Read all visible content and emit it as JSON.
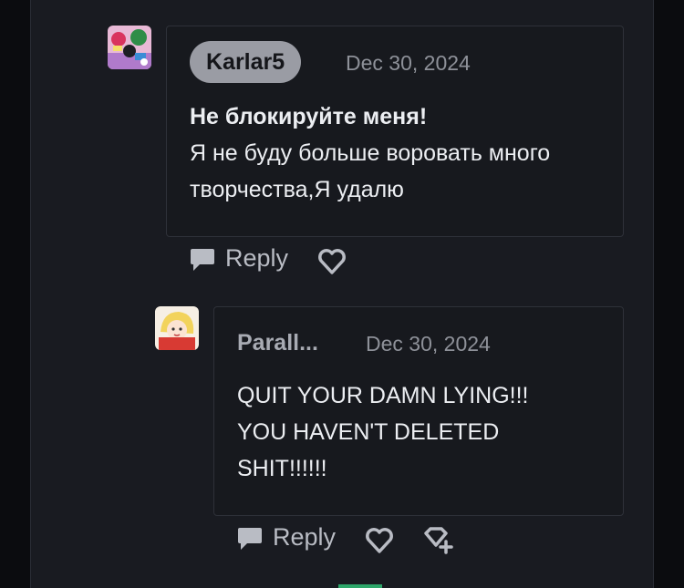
{
  "comment1": {
    "username": "Karlar5",
    "date": "Dec 30, 2024",
    "title": "Не блокируйте меня!",
    "body_line1": "Я не буду больше воровать много",
    "body_line2": "творчества,Я удалю",
    "reply_label": "Reply"
  },
  "comment2": {
    "username": "Parall...",
    "date": "Dec 30, 2024",
    "body_line1": "QUIT YOUR DAMN LYING!!!",
    "body_line2": "YOU HAVEN'T DELETED",
    "body_line3": "SHIT!!!!!!",
    "reply_label": "Reply"
  },
  "colors": {
    "panel": "#191b21",
    "background": "#0b0c0f",
    "username_pill": "#9a9ca4",
    "text": "#eceef2",
    "muted": "#8e9199"
  },
  "icons": {
    "reply": "speech-bubble-icon",
    "like": "heart-outline-icon",
    "award": "heart-plus-icon"
  }
}
